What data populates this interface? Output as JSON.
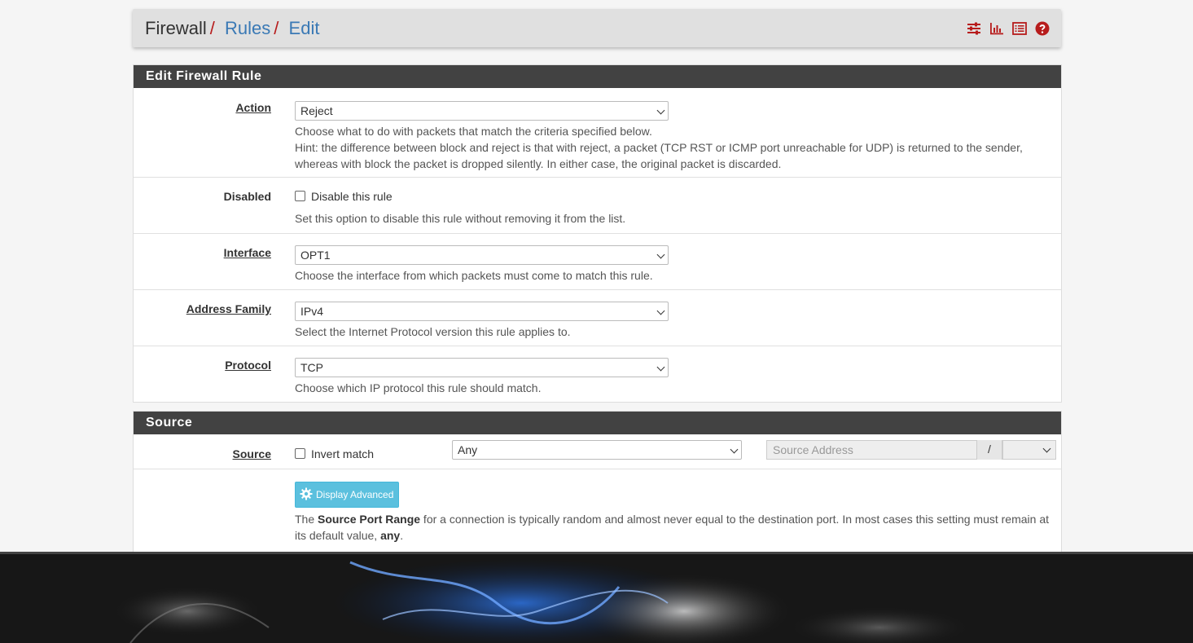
{
  "breadcrumb": {
    "items": [
      "Firewall",
      "Rules",
      "Edit"
    ],
    "separator": "/"
  },
  "header_icons": [
    "sliders-icon",
    "bar-chart-icon",
    "list-icon",
    "help-icon"
  ],
  "colors": {
    "accent_red": "#b71c1c",
    "link_blue": "#3a79b5",
    "panel_heading": "#424242",
    "info_button": "#5bc0de"
  },
  "edit_panel": {
    "title": "Edit Firewall Rule",
    "action": {
      "label": "Action",
      "value": "Reject",
      "help1": "Choose what to do with packets that match the criteria specified below.",
      "help2": "Hint: the difference between block and reject is that with reject, a packet (TCP RST or ICMP port unreachable for UDP) is returned to the sender,",
      "help3": "whereas with block the packet is dropped silently. In either case, the original packet is discarded."
    },
    "disabled": {
      "label": "Disabled",
      "checkbox_label": "Disable this rule",
      "help": "Set this option to disable this rule without removing it from the list."
    },
    "interface": {
      "label": "Interface",
      "value": "OPT1",
      "help": "Choose the interface from which packets must come to match this rule."
    },
    "address_family": {
      "label": "Address Family",
      "value": "IPv4",
      "help": "Select the Internet Protocol version this rule applies to."
    },
    "protocol": {
      "label": "Protocol",
      "value": "TCP",
      "help": "Choose which IP protocol this rule should match."
    }
  },
  "source_panel": {
    "title": "Source",
    "source": {
      "label": "Source",
      "invert_label": "Invert match",
      "type_value": "Any",
      "address_placeholder": "Source Address",
      "slash": "/",
      "mask_value": ""
    },
    "advanced": {
      "button_label": "Display Advanced",
      "help_pre": "The ",
      "help_bold": "Source Port Range",
      "help_mid": " for a connection is typically random and almost never equal to the destination port. In most cases this setting must remain at",
      "help_line2_pre": "its default value, ",
      "help_line2_bold": "any",
      "help_line2_post": "."
    }
  }
}
